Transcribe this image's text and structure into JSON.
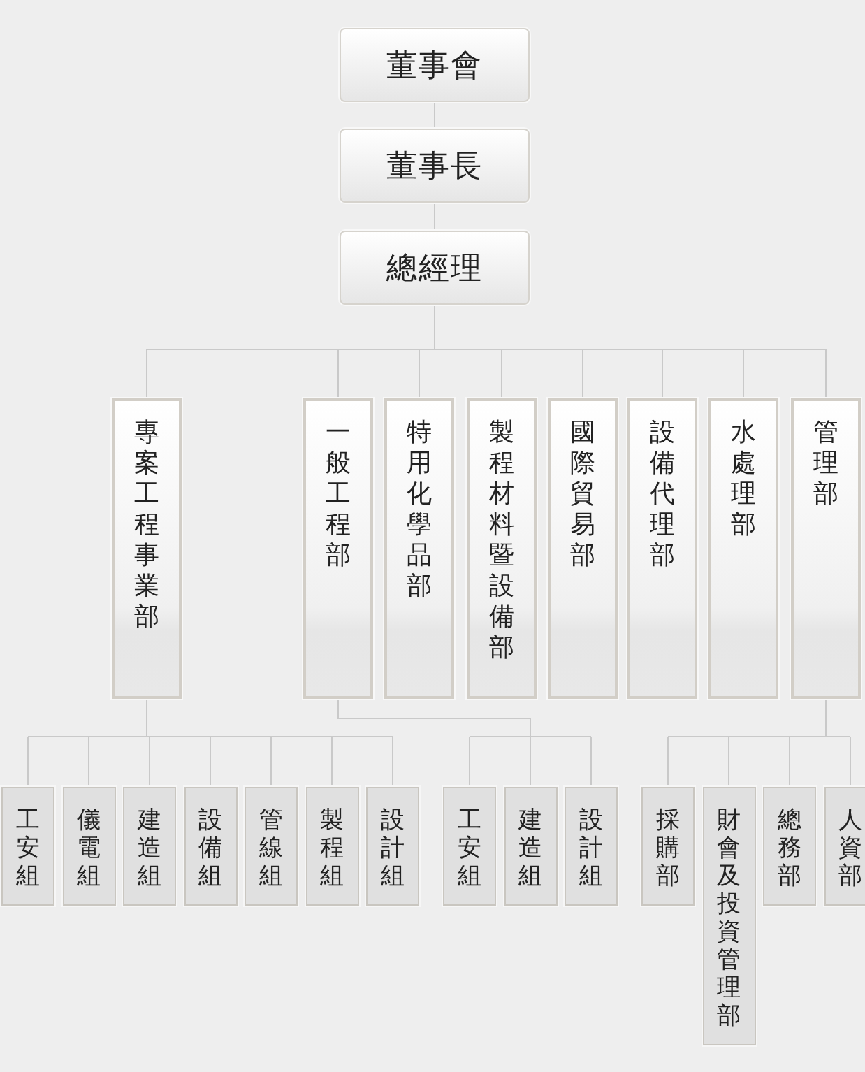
{
  "leadership": [
    "董事會",
    "董事長",
    "總經理"
  ],
  "departments": [
    {
      "name": "專案工程事業部",
      "units": [
        "工安組",
        "儀電組",
        "建造組",
        "設備組",
        "管線組",
        "製程組",
        "設計組"
      ]
    },
    {
      "name": "一般工程部",
      "units": [
        "工安組",
        "建造組",
        "設計組"
      ]
    },
    {
      "name": "特用化學品部"
    },
    {
      "name": "製程材料暨設備部"
    },
    {
      "name": "國際貿易部"
    },
    {
      "name": "設備代理部"
    },
    {
      "name": "水處理部"
    },
    {
      "name": "管理部",
      "units": [
        "採購部",
        "財會及投資管理部",
        "總務部",
        "人資部"
      ]
    }
  ]
}
